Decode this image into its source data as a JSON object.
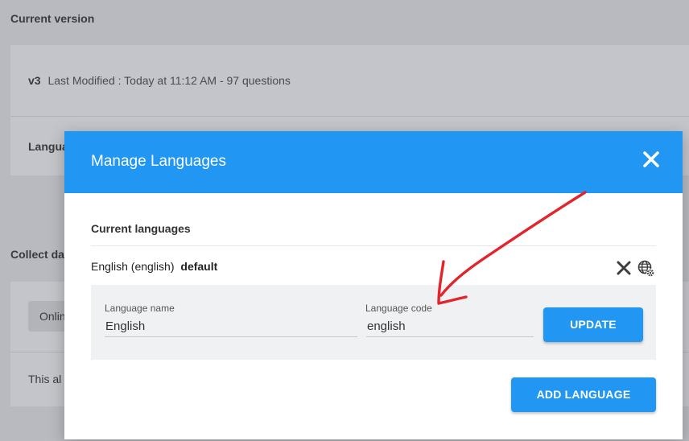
{
  "background": {
    "current_version_heading": "Current version",
    "version_tag": "v3",
    "version_meta": "Last Modified : Today at 11:12 AM - 97 questions",
    "languages_row_partial": "Langua",
    "collect_heading_partial": "Collect da",
    "online_button_partial": "Onlin",
    "info_text_partial": "This al"
  },
  "modal": {
    "title": "Manage Languages",
    "close_icon": "close-icon",
    "current_languages_label": "Current languages",
    "language_entry": {
      "name": "English (english)",
      "default_tag": "default"
    },
    "row_icons": [
      "remove-icon",
      "globe-settings-icon"
    ],
    "edit": {
      "name_label": "Language name",
      "name_value": "English",
      "code_label": "Language code",
      "code_value": "english",
      "update_label": "UPDATE"
    },
    "add_language_label": "ADD LANGUAGE"
  },
  "colors": {
    "accent": "#2196f3",
    "annotation_arrow": "#e3242b"
  }
}
